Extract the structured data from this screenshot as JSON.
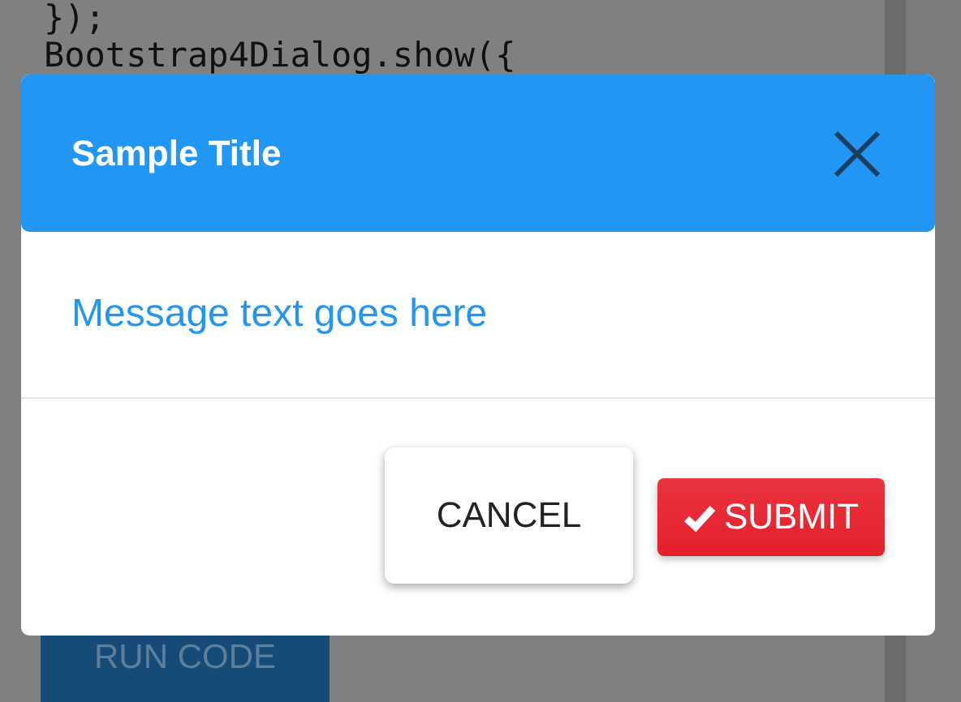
{
  "code_lines": [
    "});",
    "Bootstrap4Dialog.show({"
  ],
  "background_button": {
    "label": "RUN CODE"
  },
  "dialog": {
    "title": "Sample Title",
    "message": "Message text goes here",
    "buttons": [
      {
        "label": "CANCEL",
        "kind": "default"
      },
      {
        "label": "SUBMIT",
        "kind": "danger"
      }
    ]
  }
}
